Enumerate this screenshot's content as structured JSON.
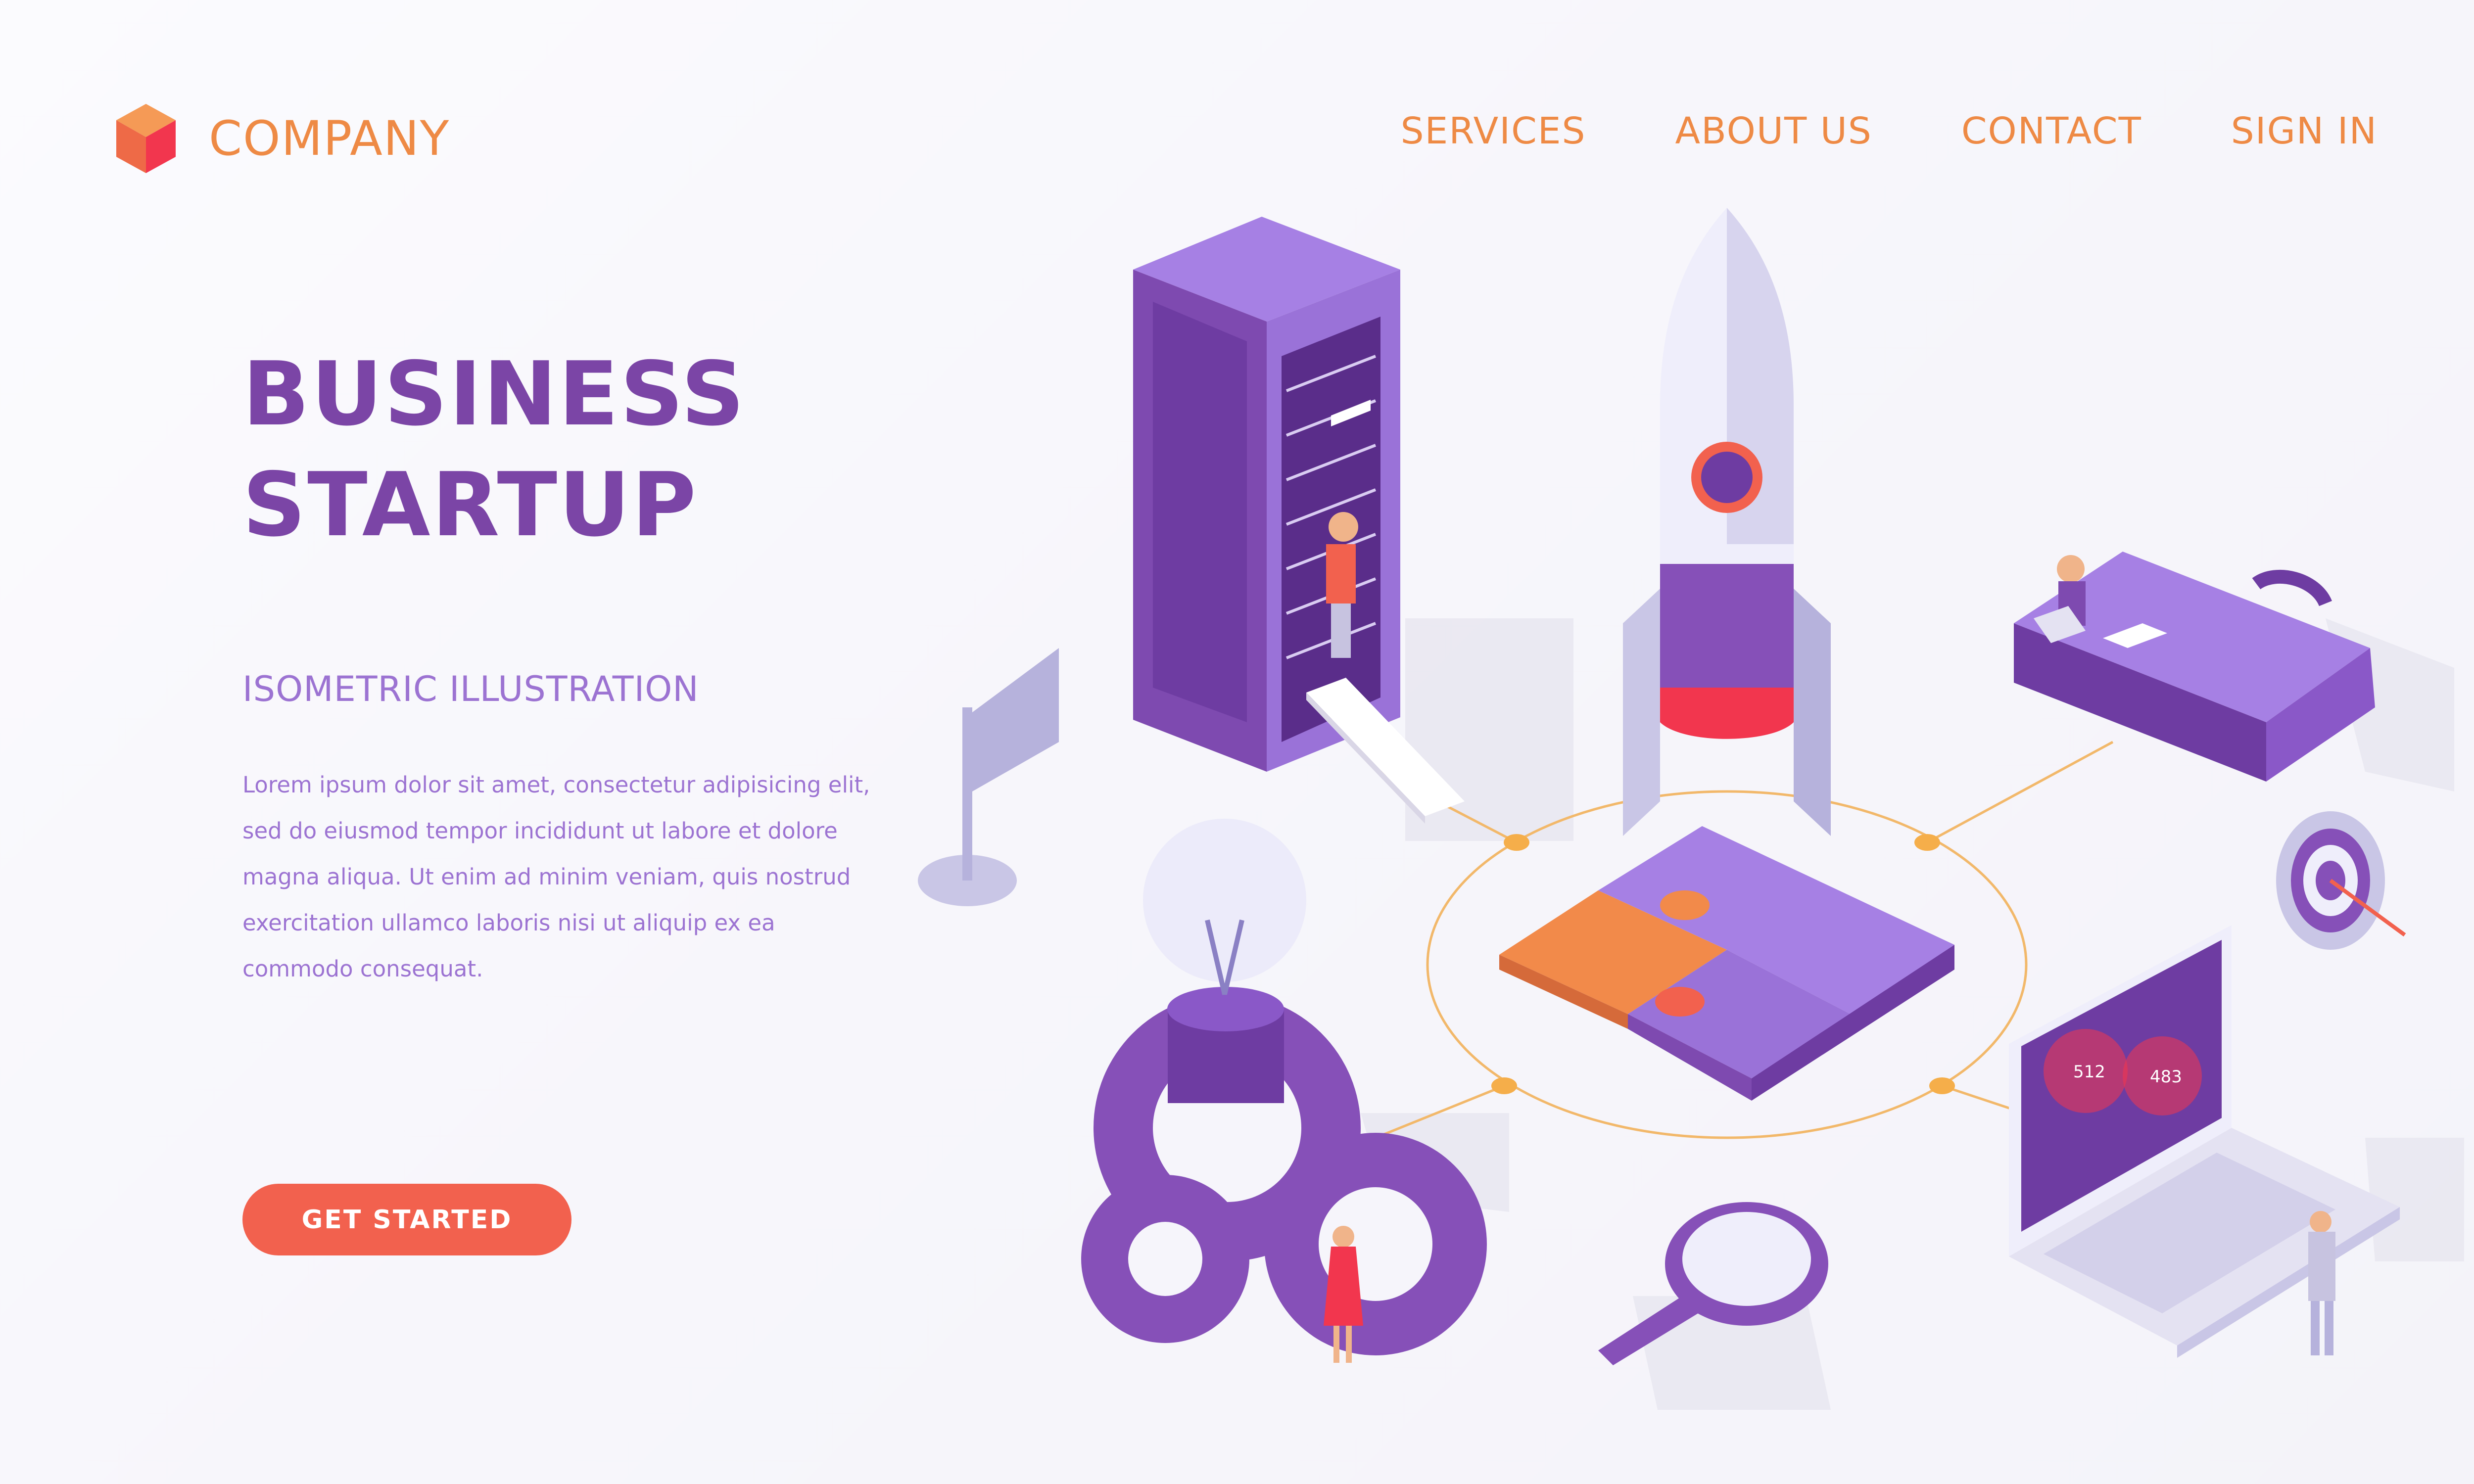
{
  "header": {
    "logo_text": "COMPANY",
    "nav": [
      {
        "label": "SERVICES"
      },
      {
        "label": "ABOUT US"
      },
      {
        "label": "CONTACT"
      },
      {
        "label": "SIGN IN"
      }
    ]
  },
  "hero": {
    "title_line1": "BUSINESS",
    "title_line2": "STARTUP",
    "subtitle": "ISOMETRIC ILLUSTRATION",
    "body": "Lorem ipsum dolor sit amet, consectetur adipisicing elit, sed do eiusmod tempor incididunt ut labore et dolore magna aliqua. Ut enim ad minim veniam, quis nostrud exercitation ullamco laboris nisi ut aliquip ex ea commodo consequat.",
    "cta_label": "GET STARTED"
  },
  "illustration": {
    "laptop_values": [
      "512",
      "483"
    ],
    "icons": [
      "server-rack-icon",
      "rocket-icon",
      "briefcase-icon",
      "flag-icon",
      "lightbulb-icon",
      "gears-icon",
      "puzzle-icon",
      "target-icon",
      "laptop-icon",
      "magnifier-icon"
    ]
  },
  "colors": {
    "brand_purple": "#7b45a6",
    "accent_orange": "#ee8a45",
    "cta_red": "#f2614e",
    "text_lilac": "#9c73d2",
    "background": "#f7f6fb"
  }
}
